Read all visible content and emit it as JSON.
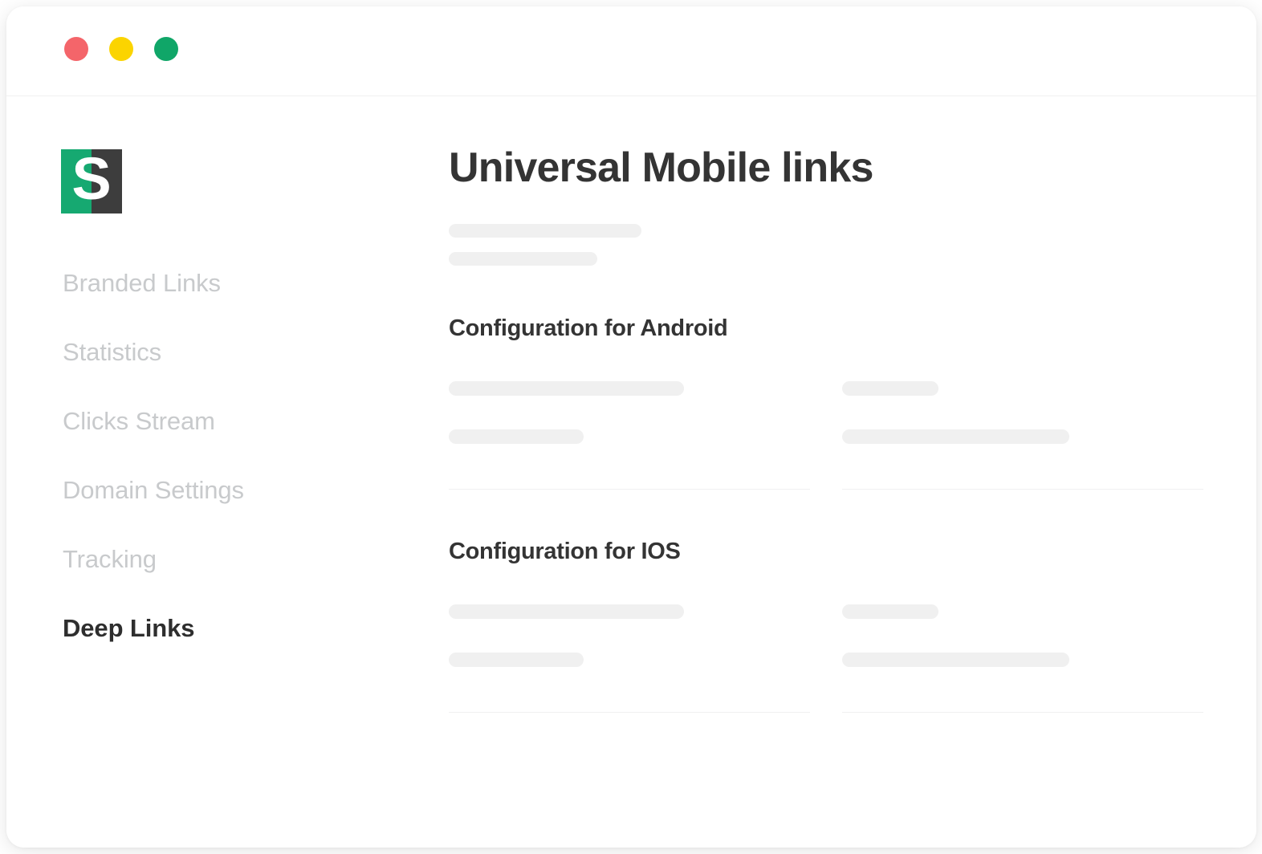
{
  "window": {
    "traffic_lights": [
      {
        "name": "close",
        "color": "#f4656a"
      },
      {
        "name": "minimize",
        "color": "#fbd400"
      },
      {
        "name": "zoom",
        "color": "#10a668"
      }
    ]
  },
  "brand": {
    "logo_letter": "S",
    "logo_green": "#16a971",
    "logo_dark": "#3d3d3d"
  },
  "sidebar": {
    "items": [
      {
        "label": "Branded Links",
        "active": false
      },
      {
        "label": "Statistics",
        "active": false
      },
      {
        "label": "Clicks Stream",
        "active": false
      },
      {
        "label": "Domain Settings",
        "active": false
      },
      {
        "label": "Tracking",
        "active": false
      },
      {
        "label": "Deep Links",
        "active": true
      }
    ]
  },
  "main": {
    "page_title": "Universal Mobile links",
    "sections": [
      {
        "title": "Configuration for Android"
      },
      {
        "title": "Configuration for IOS"
      }
    ]
  },
  "colors": {
    "text_dark": "#343434",
    "text_muted": "#c8cacc",
    "skeleton": "#f0f0f0",
    "divider": "#f0f0f1",
    "window_bg": "#ffffff"
  }
}
